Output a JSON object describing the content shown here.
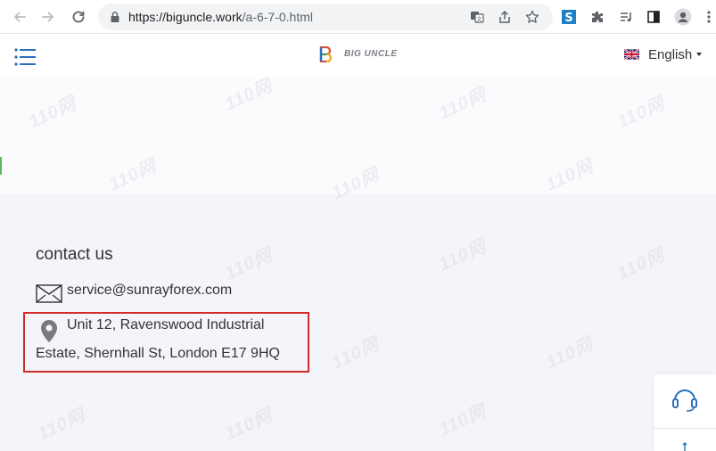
{
  "browser": {
    "url_host": "https://biguncle.work",
    "url_path": "/a-6-7-0.html",
    "icons": [
      "back-arrow-icon",
      "forward-arrow-icon",
      "reload-icon",
      "lock-icon",
      "translate-icon",
      "share-icon",
      "bookmark-star-icon",
      "s-extension-icon",
      "puzzle-extensions-icon",
      "media-queue-icon",
      "side-panel-icon",
      "profile-avatar-icon",
      "kebab-menu-icon"
    ]
  },
  "site": {
    "logo_text": "BIG UNCLE",
    "language": "English",
    "contact": {
      "title": "contact us",
      "email": "service@sunrayforex.com",
      "address_line1": "Unit 12, Ravenswood Industrial",
      "address_line2": "Estate, Shernhall St, London E17 9HQ"
    }
  },
  "watermark": "110网",
  "colors": {
    "accent_blue": "#2a6fbd",
    "highlight_red": "#d42a2a",
    "contact_bg": "#f4f5fa"
  }
}
